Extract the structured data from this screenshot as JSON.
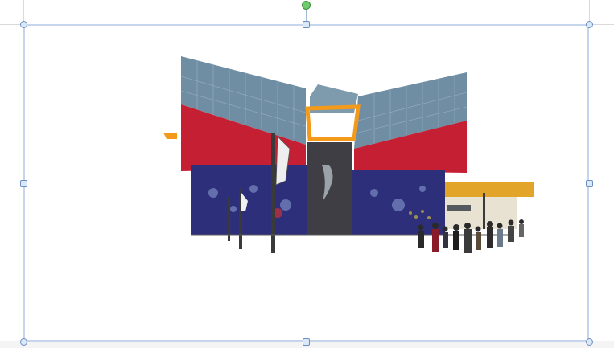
{
  "canvas": {
    "background": "#ffffff",
    "guide_color": "#d9d9d9"
  },
  "selection": {
    "frame_color": "#c5d6ec",
    "handle_fill": "#dbe8f8",
    "handle_border": "#6b8fbf",
    "rotate_handle_color": "#6ccc6c",
    "handles": [
      "top-left",
      "top-center",
      "top-right",
      "middle-left",
      "middle-right",
      "bottom-left",
      "bottom-center",
      "bottom-right"
    ]
  },
  "image": {
    "subject": "building-photo",
    "colors": {
      "glass": "#6f8ea3",
      "red_band": "#c51f33",
      "blue_wall": "#2e2f7a",
      "orange_frame": "#f39a1a",
      "gray_tower": "#3e3e44"
    }
  }
}
